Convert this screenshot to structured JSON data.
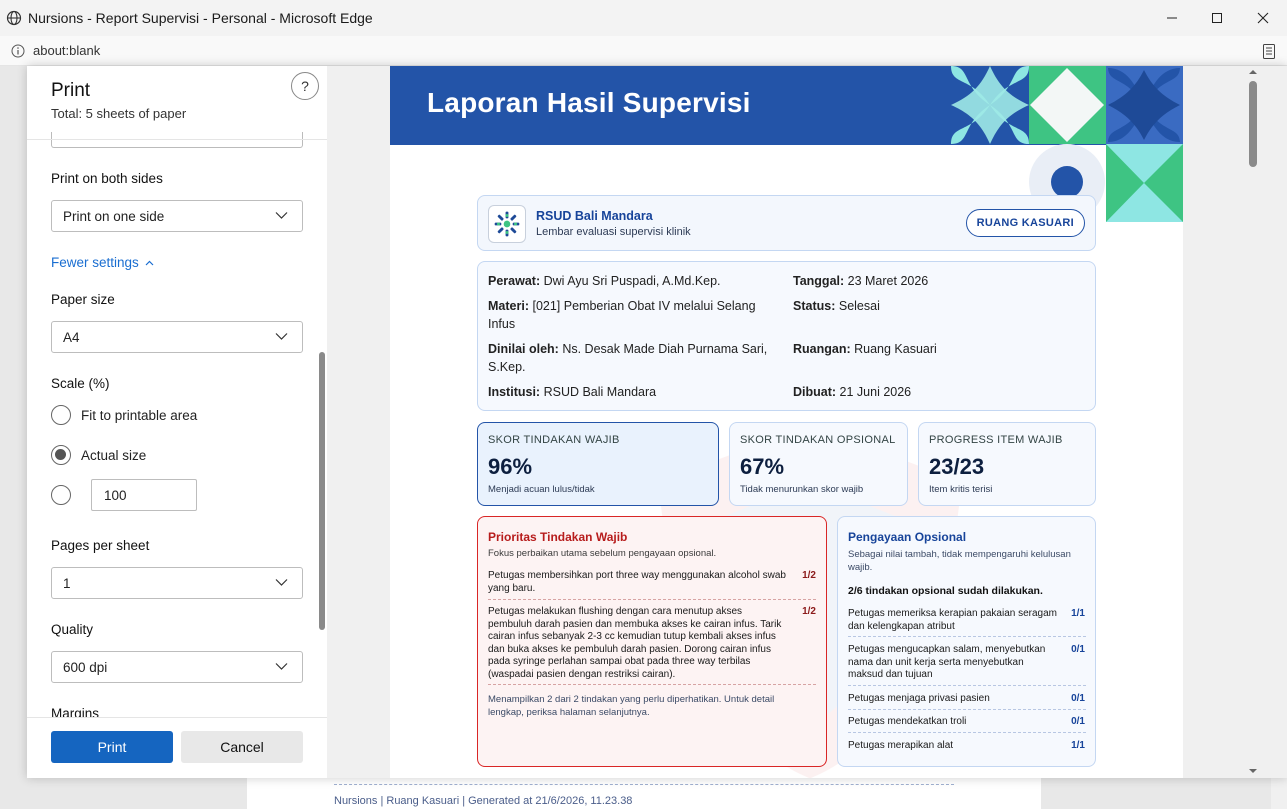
{
  "window": {
    "title": "Nursions - Report Supervisi - Personal - Microsoft Edge",
    "url": "about:blank"
  },
  "print": {
    "title": "Print",
    "total": "Total: 5 sheets of paper",
    "help": "?",
    "both_sides_label": "Print on both sides",
    "both_sides_value": "Print on one side",
    "fewer_settings": "Fewer settings",
    "paper_size_label": "Paper size",
    "paper_size_value": "A4",
    "scale_label": "Scale (%)",
    "scale_fit": "Fit to printable area",
    "scale_actual": "Actual size",
    "scale_custom_value": "100",
    "pages_per_sheet_label": "Pages per sheet",
    "pages_per_sheet_value": "1",
    "quality_label": "Quality",
    "quality_value": "600 dpi",
    "margins_label": "Margins",
    "print_button": "Print",
    "cancel_button": "Cancel"
  },
  "report": {
    "title": "Laporan Hasil Supervisi",
    "hospital": "RSUD Bali Mandara",
    "hospital_sub": "Lembar evaluasi supervisi klinik",
    "room_badge": "RUANG KASUARI",
    "fields": {
      "perawat_label": "Perawat:",
      "perawat": "Dwi Ayu Sri Puspadi, A.Md.Kep.",
      "tanggal_label": "Tanggal:",
      "tanggal": "23 Maret 2026",
      "materi_label": "Materi:",
      "materi": "[021] Pemberian Obat IV melalui Selang Infus",
      "status_label": "Status:",
      "status": "Selesai",
      "dinilai_label": "Dinilai oleh:",
      "dinilai": "Ns. Desak Made Diah Purnama Sari, S.Kep.",
      "ruangan_label": "Ruangan:",
      "ruangan": "Ruang Kasuari",
      "institusi_label": "Institusi:",
      "institusi": "RSUD Bali Mandara",
      "dibuat_label": "Dibuat:",
      "dibuat": "21 Juni 2026"
    },
    "cards": [
      {
        "title": "SKOR TINDAKAN WAJIB",
        "value": "96%",
        "sub": "Menjadi acuan lulus/tidak"
      },
      {
        "title": "SKOR TINDAKAN OPSIONAL",
        "value": "67%",
        "sub": "Tidak menurunkan skor wajib"
      },
      {
        "title": "PROGRESS ITEM WAJIB",
        "value": "23/23",
        "sub": "Item kritis terisi"
      }
    ],
    "priority": {
      "title": "Prioritas Tindakan Wajib",
      "sub": "Fokus perbaikan utama sebelum pengayaan opsional.",
      "items": [
        {
          "text": "Petugas membersihkan port three way menggunakan alcohol swab yang baru.",
          "score": "1/2"
        },
        {
          "text": "Petugas melakukan flushing dengan cara menutup akses pembuluh darah pasien dan membuka akses ke cairan infus. Tarik cairan infus sebanyak 2-3 cc kemudian tutup kembali akses infus dan buka akses ke pembuluh darah pasien. Dorong cairan infus pada syringe perlahan sampai obat pada three way terbilas (waspadai pasien dengan restriksi cairan).",
          "score": "1/2"
        }
      ],
      "note": "Menampilkan 2 dari 2 tindakan yang perlu diperhatikan. Untuk detail lengkap, periksa halaman selanjutnya."
    },
    "optional": {
      "title": "Pengayaan Opsional",
      "sub": "Sebagai nilai tambah, tidak mempengaruhi kelulusan wajib.",
      "summary": "2/6 tindakan opsional sudah dilakukan.",
      "items": [
        {
          "text": "Petugas memeriksa kerapian pakaian seragam dan kelengkapan atribut",
          "score": "1/1"
        },
        {
          "text": "Petugas mengucapkan salam, menyebutkan nama dan unit kerja serta menyebutkan maksud dan tujuan",
          "score": "0/1"
        },
        {
          "text": "Petugas menjaga privasi pasien",
          "score": "0/1"
        },
        {
          "text": "Petugas mendekatkan troli",
          "score": "0/1"
        },
        {
          "text": "Petugas merapikan alat",
          "score": "1/1"
        }
      ]
    }
  },
  "background_footer": "Nursions | Ruang Kasuari | Generated at 21/6/2026, 11.23.38"
}
